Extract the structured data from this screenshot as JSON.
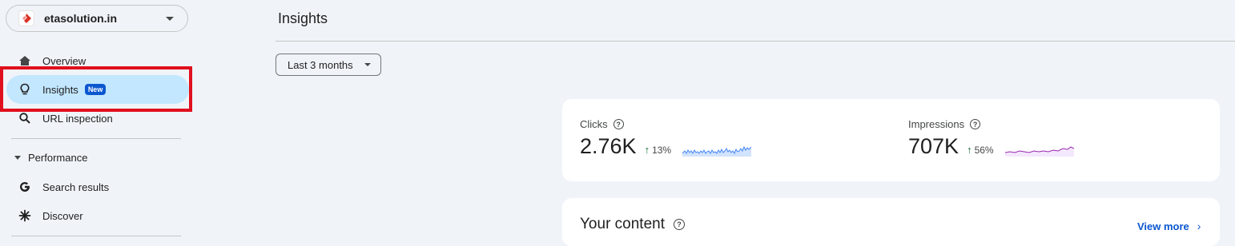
{
  "property": {
    "name": "etasolution.in",
    "logo_icon": "site-logo-icon"
  },
  "nav": {
    "overview": {
      "label": "Overview",
      "icon": "home-icon"
    },
    "insights": {
      "label": "Insights",
      "badge": "New",
      "icon": "lightbulb-icon"
    },
    "url_inspection": {
      "label": "URL inspection",
      "icon": "search-icon"
    }
  },
  "performance": {
    "label": "Performance",
    "items": [
      {
        "label": "Search results",
        "icon": "google-g-icon"
      },
      {
        "label": "Discover",
        "icon": "asterisk-icon"
      }
    ]
  },
  "page": {
    "title": "Insights",
    "date_range": "Last 3 months"
  },
  "metrics": {
    "clicks": {
      "label": "Clicks",
      "value": "2.76K",
      "delta": "13%",
      "color": "#4285f4"
    },
    "impressions": {
      "label": "Impressions",
      "value": "707K",
      "delta": "56%",
      "color": "#9c27b0"
    }
  },
  "content": {
    "title": "Your content",
    "view_more": "View more"
  },
  "colors": {
    "accent": "#0b57d0",
    "active_nav": "#c2e7ff",
    "highlight": "#e0101e",
    "up": "#137333"
  }
}
